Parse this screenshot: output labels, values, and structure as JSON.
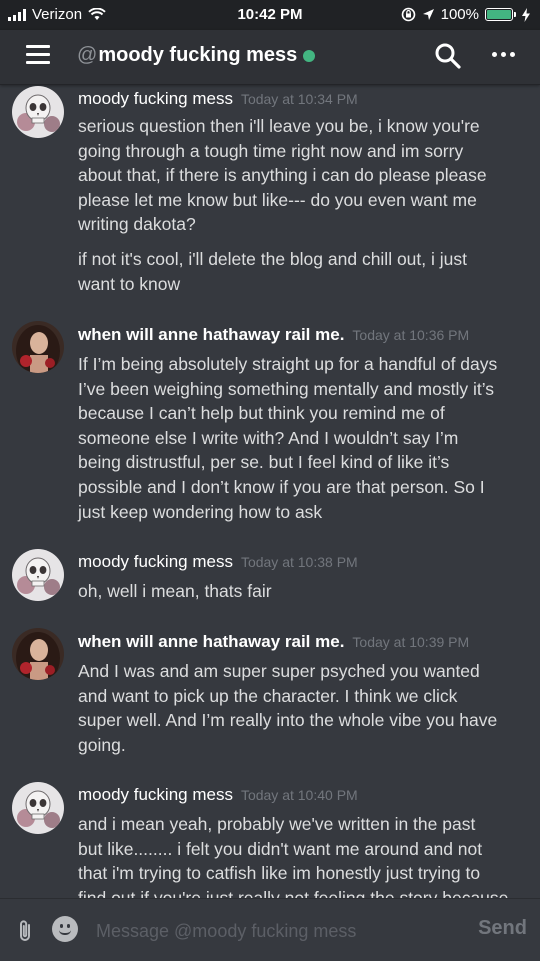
{
  "status_bar": {
    "carrier": "Verizon",
    "time": "10:42 PM",
    "battery": "100%",
    "icons": [
      "signal-icon",
      "wifi-icon",
      "orientation-lock-icon",
      "location-icon",
      "battery-icon",
      "charging-icon"
    ]
  },
  "header": {
    "at_symbol": "@",
    "channel_name": "moody fucking mess",
    "status": "online",
    "icons": [
      "hamburger-menu-icon",
      "search-icon",
      "more-options-icon"
    ]
  },
  "messages": [
    {
      "author": "moody fucking mess",
      "timestamp": "Today at 10:34 PM",
      "lines": [
        "serious question then i'll leave you be, i know you're",
        "going through a tough time right now and im sorry",
        "about that, if there is anything i can do please please",
        "please let me know but like--- do you even want me",
        "writing dakota?"
      ],
      "lines2": [
        "if not it's cool, i'll delete the blog and chill out, i just",
        "want to know"
      ]
    },
    {
      "author": "when will anne hathaway rail me.",
      "timestamp": "Today at 10:36 PM",
      "lines": [
        "If I’m being absolutely straight up for a handful of days",
        "I’ve been weighing something mentally and mostly it’s",
        "because I can’t help but think you remind me of",
        "someone else I write with? And I wouldn’t say I’m",
        "being distrustful, per se.  but I feel kind of like it’s",
        "possible and I don’t know if you are that person. So I",
        "just keep wondering how to ask"
      ]
    },
    {
      "author": "moody fucking mess",
      "timestamp": "Today at 10:38 PM",
      "lines": [
        "oh, well i mean, thats fair"
      ]
    },
    {
      "author": "when will anne hathaway rail me.",
      "timestamp": "Today at 10:39 PM",
      "lines": [
        "And I was and am super super psyched you wanted",
        "and want to pick up the character. I think we click",
        "super well. And I’m really into the whole vibe you have",
        "going."
      ]
    },
    {
      "author": "moody fucking mess",
      "timestamp": "Today at 10:40 PM",
      "lines": [
        "and i mean yeah, probably we've written in the past",
        "but like........ i felt you didn't want me around and not",
        "that i'm trying to catfish like im honestly just trying to",
        "find out if you're just really not feeling the story because"
      ]
    }
  ],
  "input": {
    "placeholder": "Message @moody fucking mess",
    "send_label": "Send"
  },
  "colors": {
    "background": "#36393f",
    "header": "#2f3136",
    "online": "#43b581",
    "timestamp": "#72767d"
  }
}
